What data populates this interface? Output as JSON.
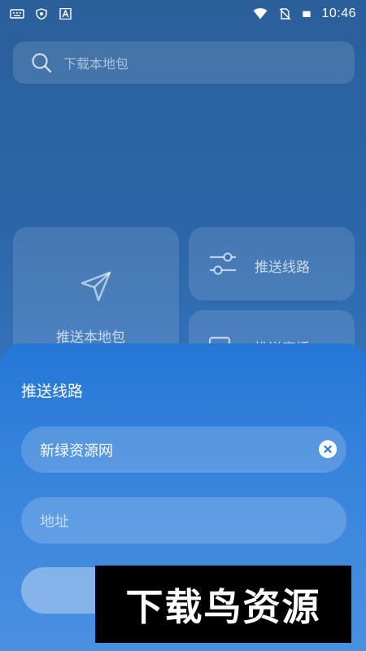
{
  "status_bar": {
    "time": "10:46",
    "left_icons": [
      "keyboard-icon",
      "shield-icon",
      "a-letter-icon"
    ],
    "right_icons": [
      "wifi-icon",
      "no-sim-icon",
      "battery-charging-icon"
    ]
  },
  "search": {
    "placeholder": "下载本地包",
    "icon": "search-icon"
  },
  "cards": {
    "push_local": {
      "label": "推送本地包",
      "icon": "send-icon"
    },
    "push_line": {
      "label": "推送线路",
      "icon": "sliders-icon"
    },
    "push_stream": {
      "label": "推送直播",
      "icon": "video-icon"
    }
  },
  "sheet": {
    "title": "推送线路",
    "name_value": "新绿资源网",
    "address_placeholder": "地址"
  },
  "watermark": {
    "text": "下载鸟资源"
  },
  "colors": {
    "sheet_blue": "#2577d6",
    "background_blue": "#2c66a8"
  }
}
